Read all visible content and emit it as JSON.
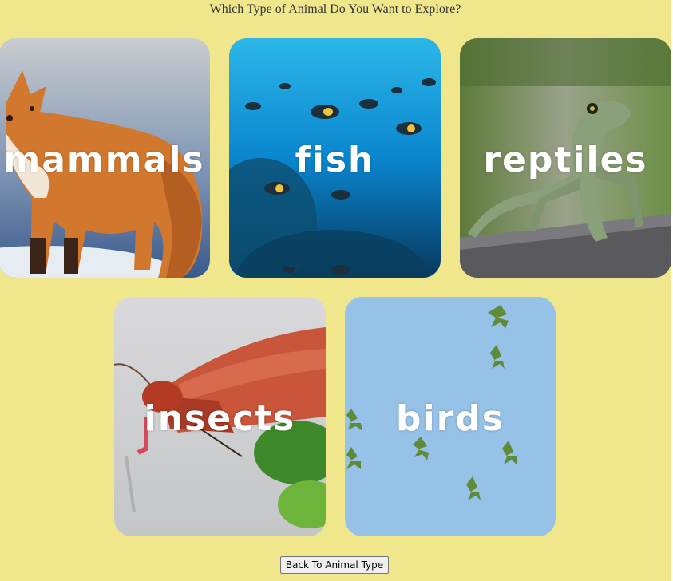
{
  "page": {
    "title": "Which Type of Animal Do You Want to Explore?"
  },
  "cards": [
    {
      "label": "mammals",
      "image": "red-fox-photo"
    },
    {
      "label": "fish",
      "image": "tropical-fish-school-photo"
    },
    {
      "label": "reptiles",
      "image": "green-lizard-photo"
    },
    {
      "label": "insects",
      "image": "red-moth-photo"
    },
    {
      "label": "birds",
      "image": "flying-parakeets-photo"
    }
  ],
  "back_button": {
    "label": "Back To Animal Type"
  },
  "colors": {
    "background": "#f0e68c",
    "card_label": "#ffffff"
  }
}
